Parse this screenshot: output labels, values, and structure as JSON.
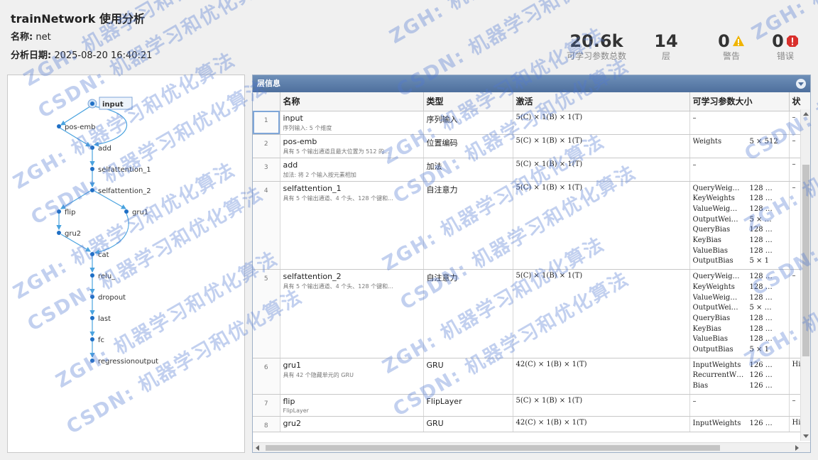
{
  "header": {
    "title": "trainNetwork 使用分析",
    "name_label": "名称:",
    "name_value": "net",
    "date_label": "分析日期:",
    "date_value": "2025-08-20 16:40:21"
  },
  "stats": {
    "params_value": "20.6k",
    "params_label": "可学习参数总数",
    "layers_value": "14",
    "layers_label": "层",
    "warnings_value": "0",
    "warnings_label": "警告",
    "errors_value": "0",
    "errors_label": "错误"
  },
  "graph": {
    "nodes": [
      "input",
      "pos-emb",
      "add",
      "selfattention_1",
      "selfattention_2",
      "flip",
      "gru1",
      "gru2",
      "cat",
      "relu_",
      "dropout",
      "last",
      "fc",
      "regressionoutput"
    ]
  },
  "table": {
    "panel_title": "层信息",
    "headers": [
      "名称",
      "类型",
      "激活",
      "可学习参数大小",
      "状"
    ],
    "rows": [
      {
        "idx": "1",
        "name": "input",
        "desc": "序列输入: 5 个维度",
        "type": "序列输入",
        "act": "5(C) × 1(B) × 1(T)",
        "params": [
          {
            "k": "–",
            "v": ""
          }
        ],
        "state": "–"
      },
      {
        "idx": "2",
        "name": "pos-emb",
        "desc": "具有 5 个输出通道且最大位置为 512 的...",
        "type": "位置编码",
        "act": "5(C) × 1(B) × 1(T)",
        "params": [
          {
            "k": "Weights",
            "v": "5 × 512"
          }
        ],
        "state": "–"
      },
      {
        "idx": "3",
        "name": "add",
        "desc": "加法: 将 2 个输入按元素相加",
        "type": "加法",
        "act": "5(C) × 1(B) × 1(T)",
        "params": [
          {
            "k": "–",
            "v": ""
          }
        ],
        "state": "–"
      },
      {
        "idx": "4",
        "name": "selfattention_1",
        "desc": "具有 5 个输出通道、4 个头、128 个键和...",
        "type": "自注意力",
        "act": "5(C) × 1(B) × 1(T)",
        "params": [
          {
            "k": "QueryWeig…",
            "v": "128 …"
          },
          {
            "k": "KeyWeights",
            "v": "128 …"
          },
          {
            "k": "ValueWeig…",
            "v": "128 …"
          },
          {
            "k": "OutputWei…",
            "v": "5 × …"
          },
          {
            "k": "QueryBias",
            "v": "128 …"
          },
          {
            "k": "KeyBias",
            "v": "128 …"
          },
          {
            "k": "ValueBias",
            "v": "128 …"
          },
          {
            "k": "OutputBias",
            "v": "5 × 1"
          }
        ],
        "state": "–"
      },
      {
        "idx": "5",
        "name": "selfattention_2",
        "desc": "具有 5 个输出通道、4 个头、128 个键和...",
        "type": "自注意力",
        "act": "5(C) × 1(B) × 1(T)",
        "params": [
          {
            "k": "QueryWeig…",
            "v": "128 …"
          },
          {
            "k": "KeyWeights",
            "v": "128 …"
          },
          {
            "k": "ValueWeig…",
            "v": "128 …"
          },
          {
            "k": "OutputWei…",
            "v": "5 × …"
          },
          {
            "k": "QueryBias",
            "v": "128 …"
          },
          {
            "k": "KeyBias",
            "v": "128 …"
          },
          {
            "k": "ValueBias",
            "v": "128 …"
          },
          {
            "k": "OutputBias",
            "v": "5 × 1"
          }
        ],
        "state": "–"
      },
      {
        "idx": "6",
        "name": "gru1",
        "desc": "具有 42 个隐藏单元的 GRU",
        "type": "GRU",
        "act": "42(C) × 1(B) × 1(T)",
        "params": [
          {
            "k": "InputWeights",
            "v": "126 …"
          },
          {
            "k": "RecurrentW…",
            "v": "126 …"
          },
          {
            "k": "Bias",
            "v": "126 …"
          }
        ],
        "state": "Hi"
      },
      {
        "idx": "7",
        "name": "flip",
        "desc": "FlipLayer",
        "type": "FlipLayer",
        "act": "5(C) × 1(B) × 1(T)",
        "params": [
          {
            "k": "–",
            "v": ""
          }
        ],
        "state": "–"
      },
      {
        "idx": "8",
        "name": "gru2",
        "desc": "",
        "type": "GRU",
        "act": "42(C) × 1(B) × 1(T)",
        "params": [
          {
            "k": "InputWeights",
            "v": "126 …"
          }
        ],
        "state": "Hi"
      }
    ]
  },
  "watermark": {
    "line_a": "ZGH: 机器学习和优化算法",
    "line_b": "CSDN: 机器学习和优化算法"
  },
  "colors": {
    "accent": "#4e6f9d",
    "node": "#1f6fc5",
    "edge": "#4aa3df",
    "warning": "#f0b400",
    "error": "#d9302c"
  }
}
